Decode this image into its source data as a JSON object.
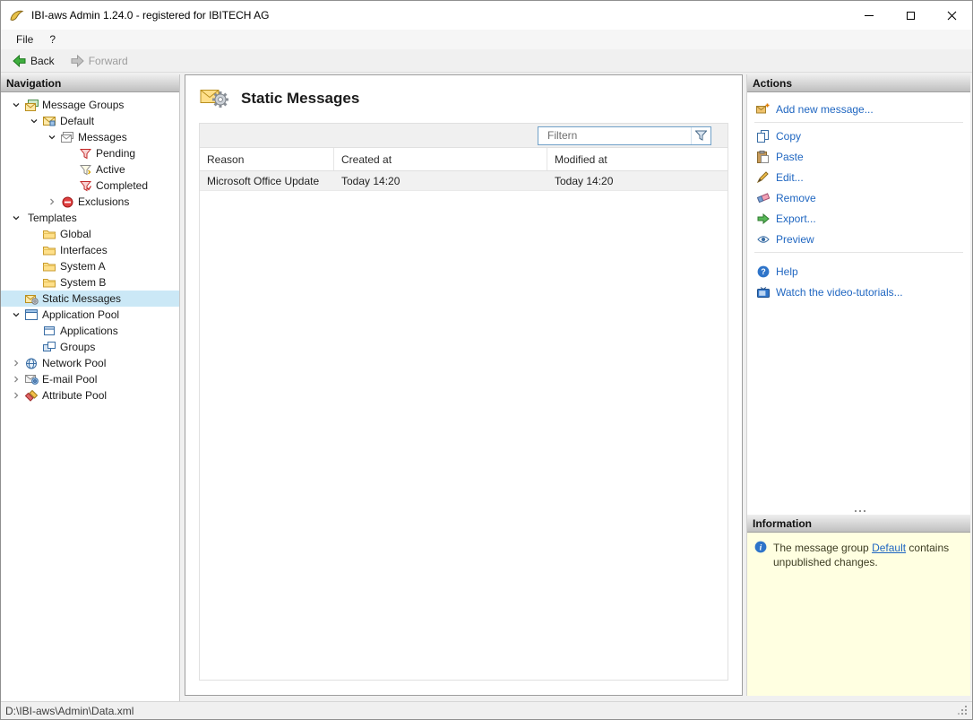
{
  "window": {
    "title": "IBI-aws Admin 1.24.0 - registered for IBITECH AG"
  },
  "icons": {
    "minimize": "minimize-icon",
    "maximize": "maximize-icon",
    "close": "close-icon",
    "back": "green-left-arrow",
    "forward": "gray-right-arrow",
    "filter": "funnel-icon",
    "info": "blue-info-circle"
  },
  "menu": {
    "file": "File",
    "help": "?"
  },
  "toolbar": {
    "back": "Back",
    "forward": "Forward"
  },
  "navigation": {
    "header": "Navigation",
    "items": [
      {
        "label": "Message Groups",
        "icon": "message-groups",
        "state": "expanded"
      },
      {
        "label": "Default",
        "icon": "message-group",
        "state": "expanded"
      },
      {
        "label": "Messages",
        "icon": "messages",
        "state": "expanded"
      },
      {
        "label": "Pending",
        "icon": "pending-filter"
      },
      {
        "label": "Active",
        "icon": "active-filter"
      },
      {
        "label": "Completed",
        "icon": "completed-filter"
      },
      {
        "label": "Exclusions",
        "icon": "exclusions",
        "state": "collapsed"
      },
      {
        "label": "Templates",
        "state": "expanded"
      },
      {
        "label": "Global",
        "icon": "folder"
      },
      {
        "label": "Interfaces",
        "icon": "folder"
      },
      {
        "label": "System A",
        "icon": "folder"
      },
      {
        "label": "System B",
        "icon": "folder"
      },
      {
        "label": "Static Messages",
        "icon": "static-messages",
        "selected": true
      },
      {
        "label": "Application Pool",
        "icon": "application-pool",
        "state": "expanded"
      },
      {
        "label": "Applications",
        "icon": "applications"
      },
      {
        "label": "Groups",
        "icon": "groups"
      },
      {
        "label": "Network Pool",
        "icon": "network-pool",
        "state": "collapsed"
      },
      {
        "label": "E-mail Pool",
        "icon": "email-pool",
        "state": "collapsed"
      },
      {
        "label": "Attribute Pool",
        "icon": "attribute-pool",
        "state": "collapsed"
      }
    ]
  },
  "main": {
    "title": "Static Messages",
    "filter": {
      "placeholder": "Filtern"
    },
    "table": {
      "columns": [
        "Reason",
        "Created at",
        "Modified at"
      ],
      "rows": [
        {
          "reason": "Microsoft Office Update",
          "created_at": "Today 14:20",
          "modified_at": "Today 14:20"
        }
      ]
    }
  },
  "actions": {
    "header": "Actions",
    "items": [
      {
        "label": "Add new message...",
        "icon": "add-message"
      },
      {
        "label": "Copy",
        "icon": "copy"
      },
      {
        "label": "Paste",
        "icon": "paste"
      },
      {
        "label": "Edit...",
        "icon": "edit"
      },
      {
        "label": "Remove",
        "icon": "remove"
      },
      {
        "label": "Export...",
        "icon": "export"
      },
      {
        "label": "Preview",
        "icon": "preview"
      },
      {
        "label": "Help",
        "icon": "help"
      },
      {
        "label": "Watch the video-tutorials...",
        "icon": "video-tutorials"
      }
    ]
  },
  "information": {
    "header": "Information",
    "message_prefix": "The message group ",
    "message_link": "Default",
    "message_suffix": " contains unpublished changes."
  },
  "statusbar": {
    "path": "D:\\IBI-aws\\Admin\\Data.xml"
  }
}
